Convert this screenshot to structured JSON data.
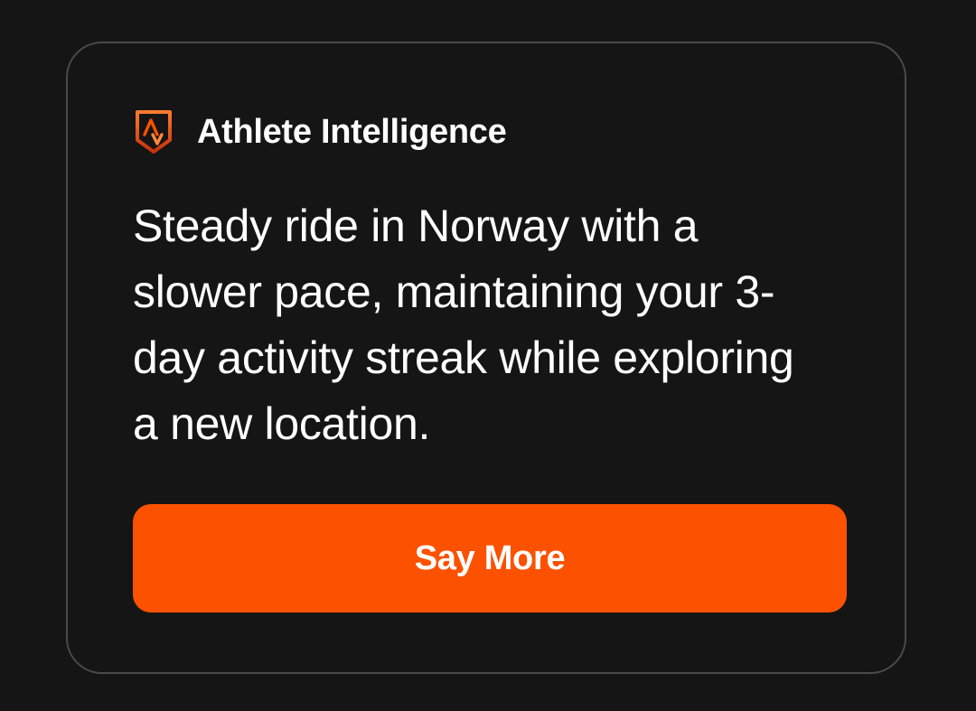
{
  "card": {
    "logo_icon": "athlete-intelligence-badge-icon",
    "title": "Athlete Intelligence",
    "summary": "Steady ride in Norway with a slower pace, maintaining your 3-day activity streak while exploring a new location.",
    "button_label": "Say More"
  },
  "colors": {
    "background": "#151515",
    "card_border": "#4a4a4a",
    "accent": "#fc5200",
    "text": "#ffffff"
  }
}
